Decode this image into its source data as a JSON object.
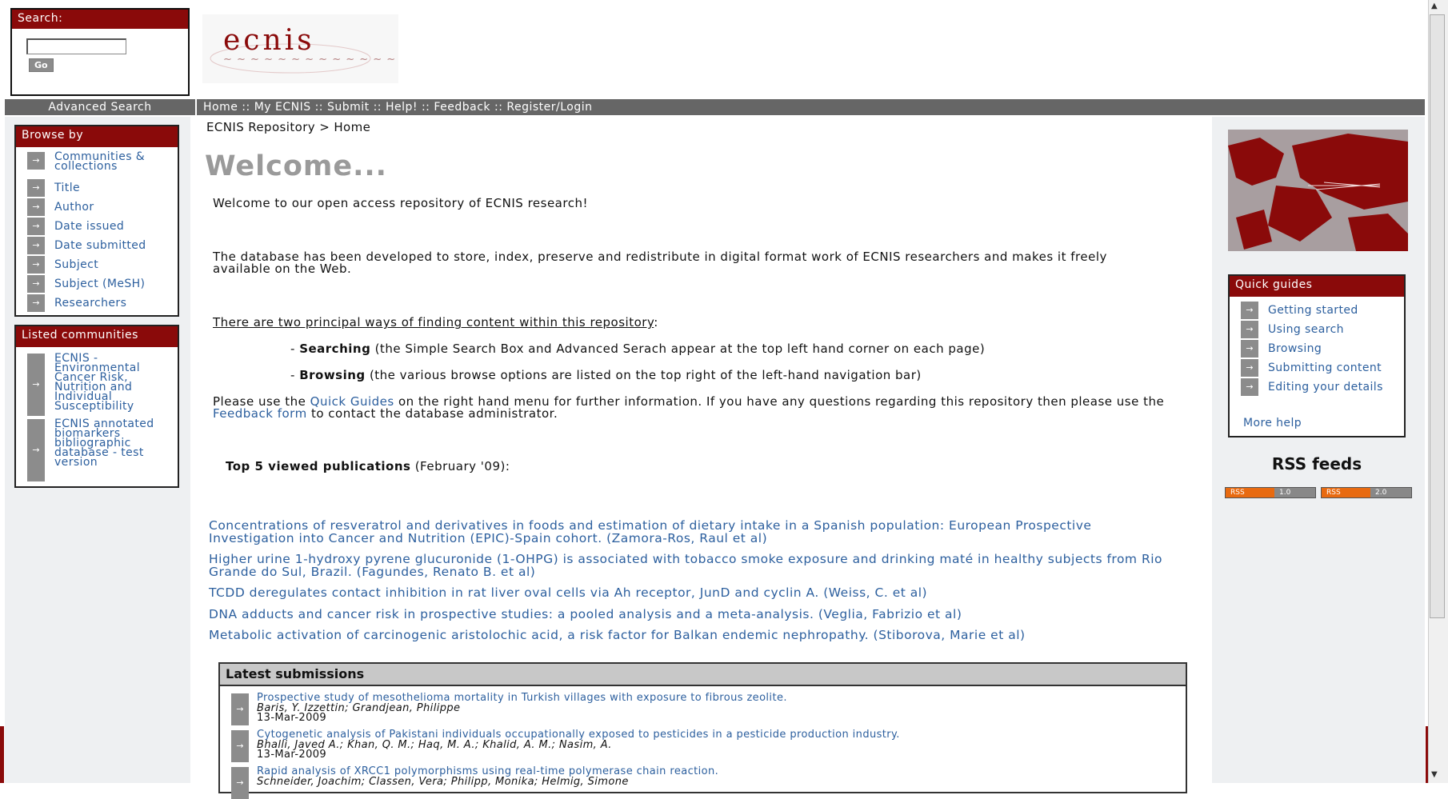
{
  "search": {
    "label": "Search:",
    "go": "Go",
    "value": ""
  },
  "logo": {
    "text": "ecnis"
  },
  "nav": {
    "advanced": "Advanced Search",
    "links": [
      "Home",
      "My ECNIS",
      "Submit",
      "Help!",
      "Feedback",
      "Register/Login"
    ],
    "separator": " :: "
  },
  "breadcrumb": "ECNIS Repository > Home",
  "welcome": "Welcome...",
  "browse": {
    "title": "Browse by",
    "items": [
      "Communities & collections",
      "Title",
      "Author",
      "Date issued",
      "Date submitted",
      "Subject",
      "Subject (MeSH)",
      "Researchers"
    ]
  },
  "communities": {
    "title": "Listed communities",
    "items": [
      "ECNIS - Environmental Cancer Risk, Nutrition and Individual Susceptibility",
      "ECNIS annotated biomarkers bibliographic database - test version"
    ]
  },
  "content": {
    "intro": "Welcome to our open access repository of ECNIS research!",
    "db": "The database has been developed to store, index, preserve and redistribute in digital format work of ECNIS researchers and makes it freely available on the Web.",
    "ways": "There are two principal ways of finding content within this repository",
    "ways_colon": ":",
    "searching_b": "Searching",
    "searching_t": " (the Simple Search Box and Advanced Serach appear at the top left hand corner on each page)",
    "browsing_b": "Browsing",
    "browsing_t": " (the various browse options are listed on the top right of the left-hand navigation bar)",
    "please_1": "Please use the ",
    "quick_link": "Quick Guides",
    "please_2": " on the right hand menu for further information. If you have any questions regarding this repository then please use the ",
    "feedback_link": "Feedback form",
    "please_3": " to contact the database administrator.",
    "top5_b": "Top 5 viewed publications",
    "top5_t": " (February '09):"
  },
  "publications": [
    "Concentrations of resveratrol and derivatives in foods and estimation of dietary intake in a Spanish population: European Prospective Investigation into Cancer and Nutrition (EPIC)-Spain cohort. (Zamora-Ros, Raul et al)",
    "Higher urine 1-hydroxy pyrene glucuronide (1-OHPG) is associated with tobacco smoke exposure and drinking maté in healthy subjects from Rio Grande do Sul, Brazil. (Fagundes, Renato B. et al)",
    "TCDD deregulates contact inhibition in rat liver oval cells via Ah receptor, JunD and cyclin A. (Weiss, C. et al)",
    "DNA adducts and cancer risk in prospective studies: a pooled analysis and a meta-analysis. (Veglia, Fabrizio et al)",
    "Metabolic activation of carcinogenic aristolochic acid, a risk factor for Balkan endemic nephropathy. (Stiborova, Marie et al)"
  ],
  "latest": {
    "title": "Latest submissions",
    "items": [
      {
        "title": "Prospective study of mesothelioma mortality in Turkish villages with exposure to fibrous zeolite.",
        "authors": "Baris, Y. Izzettin; Grandjean, Philippe",
        "date": "13-Mar-2009"
      },
      {
        "title": "Cytogenetic analysis of Pakistani individuals occupationally exposed to pesticides in a pesticide production industry.",
        "authors": "Bhalli, Javed A.; Khan, Q. M.; Haq, M. A.; Khalid, A. M.; Nasim, A.",
        "date": "13-Mar-2009"
      },
      {
        "title": "Rapid analysis of XRCC1 polymorphisms using real-time polymerase chain reaction.",
        "authors": "Schneider, Joachim; Classen, Vera; Philipp, Monika; Helmig, Simone",
        "date": ""
      }
    ]
  },
  "quickguides": {
    "title": "Quick guides",
    "items": [
      "Getting started",
      "Using search",
      "Browsing",
      "Submitting content",
      "Editing your details"
    ],
    "more": "More help"
  },
  "rss": {
    "title": "RSS feeds",
    "badges": [
      {
        "left": "RSS",
        "right": "1.0"
      },
      {
        "left": "RSS",
        "right": "2.0"
      }
    ]
  },
  "colors": {
    "accent": "#8a0a0a",
    "navbar": "#666666",
    "link": "#2c5f9e"
  }
}
